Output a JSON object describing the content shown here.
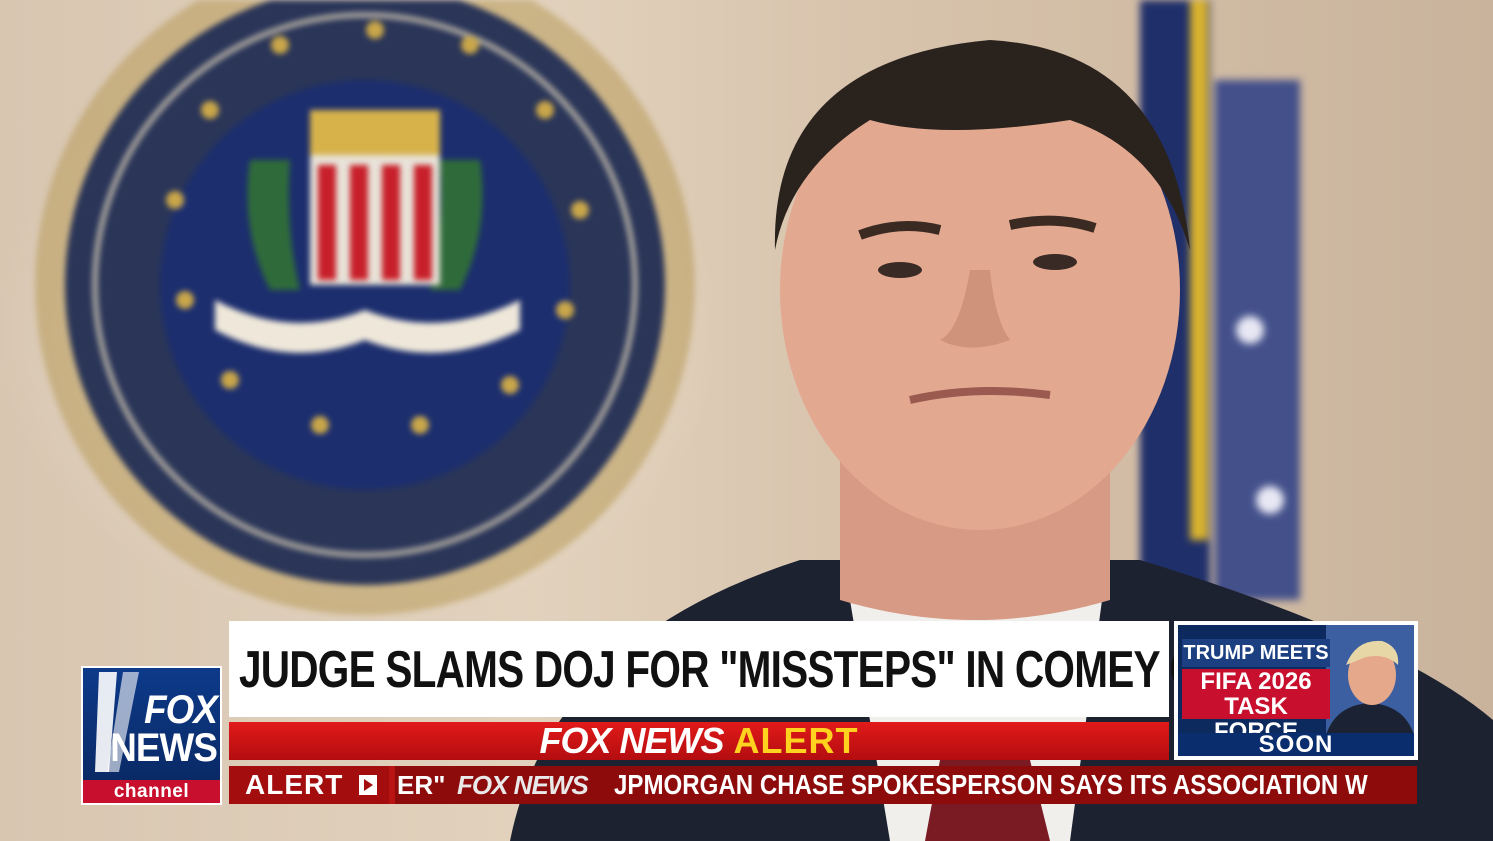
{
  "network": {
    "logo_line1": "FOX",
    "logo_line2": "NEWS",
    "logo_line3": "channel"
  },
  "headline": "JUDGE SLAMS DOJ FOR \"MISSTEPS\" IN COMEY CASE",
  "alert_bar": {
    "brand": "FOX NEWS",
    "word": "ALERT"
  },
  "ticker": {
    "label": "ALERT",
    "previous_fragment": "ER\"",
    "brand": "FOX NEWS",
    "story": "JPMORGAN CHASE SPOKESPERSON SAYS ITS ASSOCIATION W"
  },
  "promo": {
    "line1": "TRUMP MEETS",
    "line2a": "FIFA 2026",
    "line2b": "TASK FORCE",
    "status": "SOON"
  },
  "colors": {
    "fox_blue": "#0a2d6e",
    "fox_red": "#c8102e",
    "alert_yellow": "#ffd21f",
    "ticker_dark_red": "#8e0b0b"
  }
}
